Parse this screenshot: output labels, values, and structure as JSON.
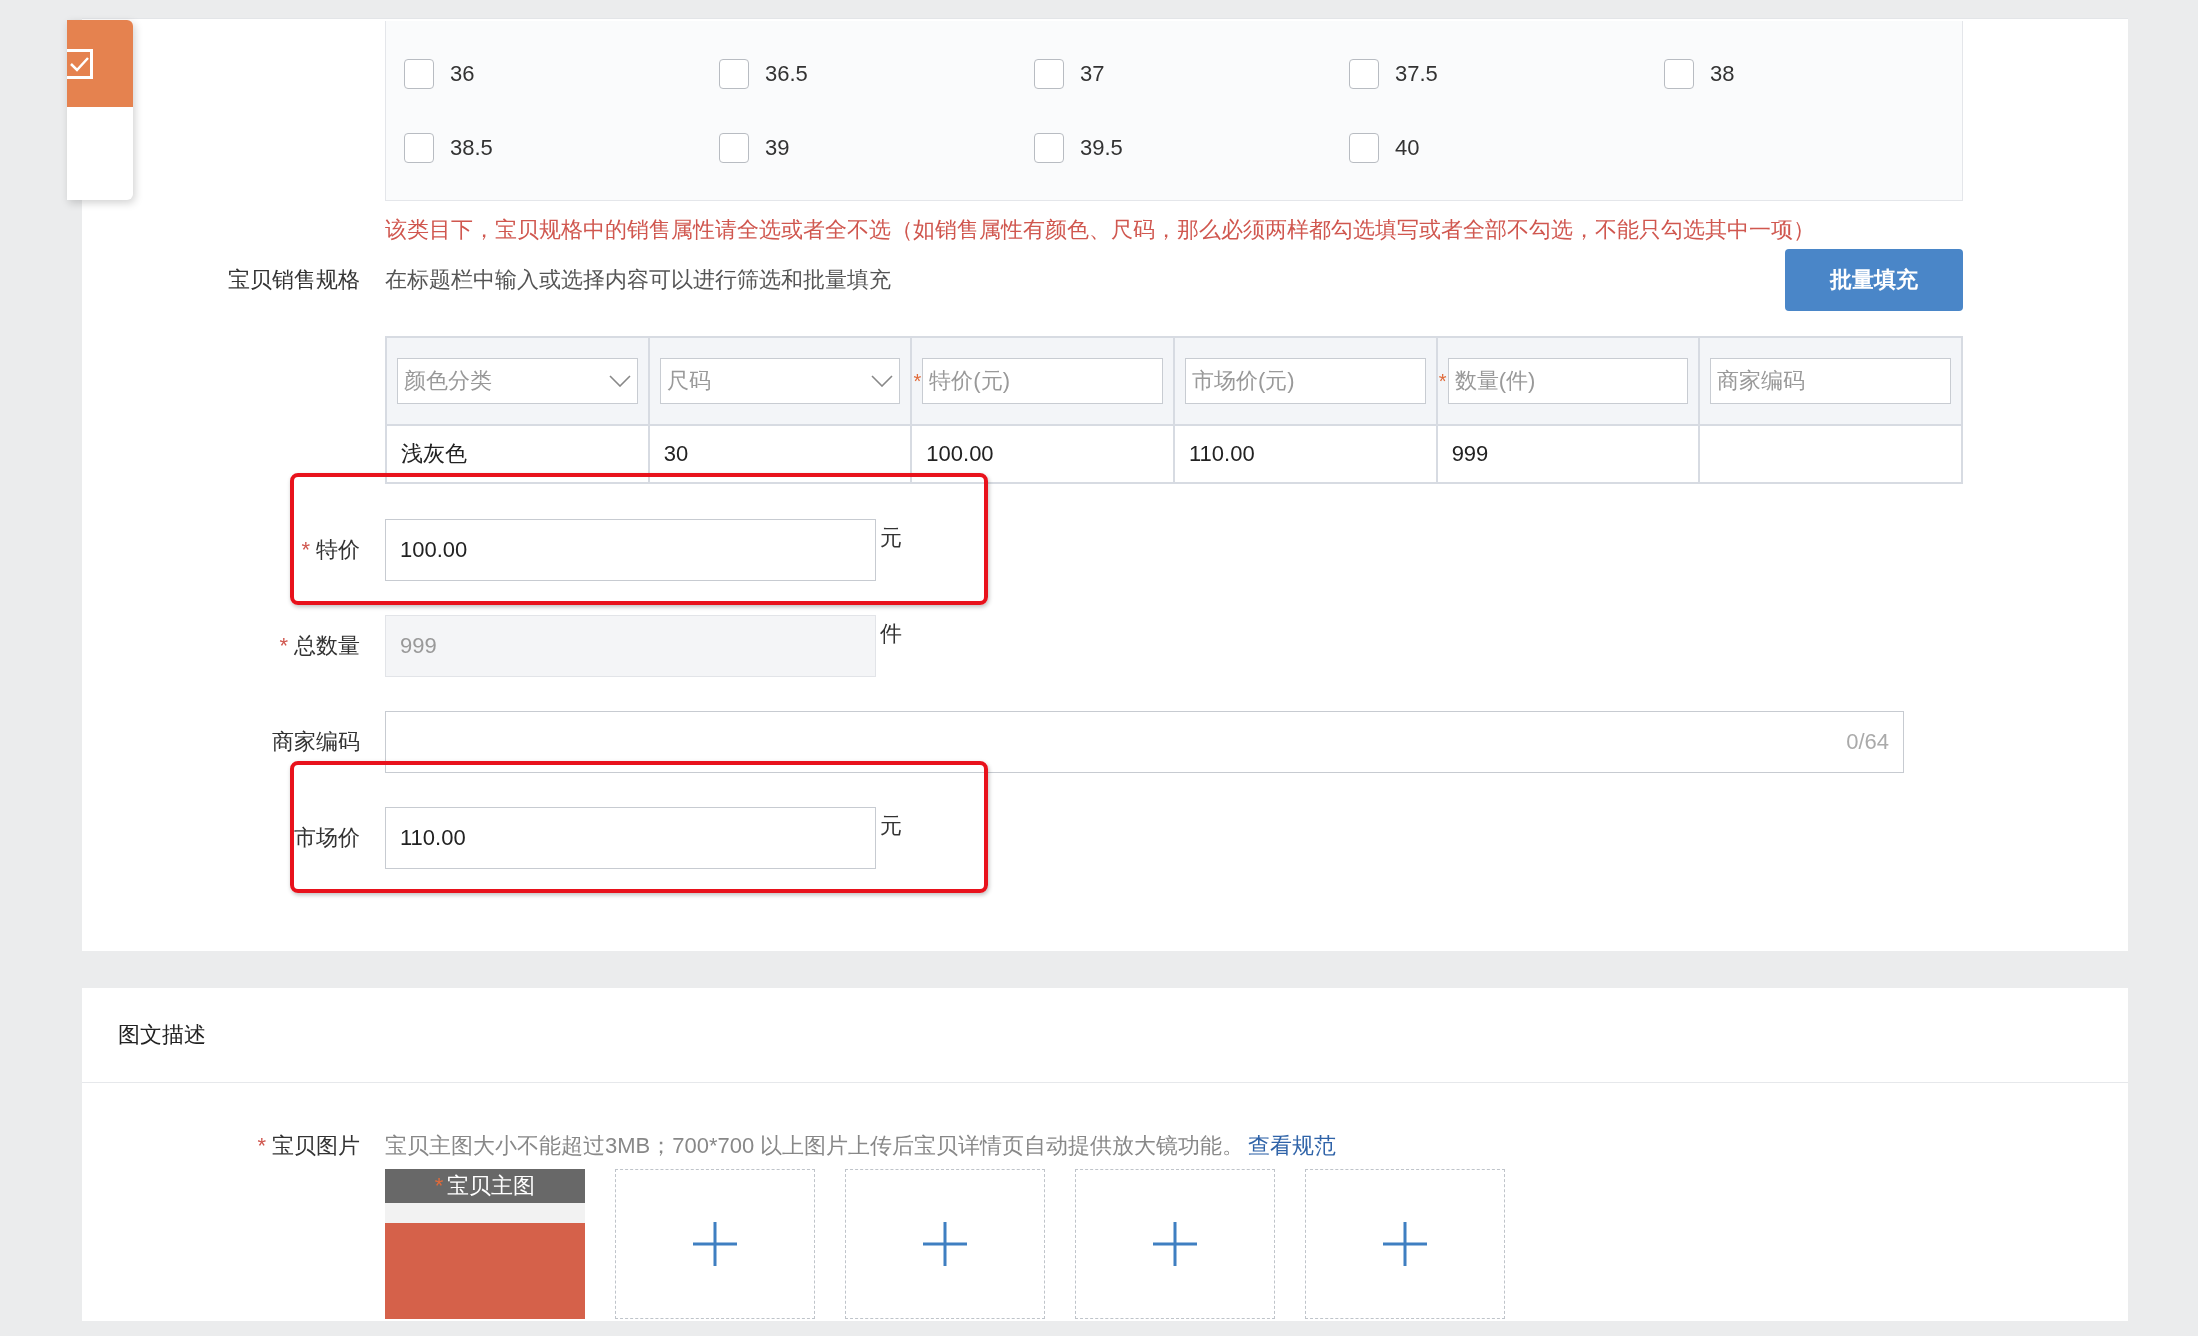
{
  "side_card": {
    "checked": true
  },
  "size_options": [
    {
      "label": "36",
      "checked": false
    },
    {
      "label": "36.5",
      "checked": false
    },
    {
      "label": "37",
      "checked": false
    },
    {
      "label": "37.5",
      "checked": false
    },
    {
      "label": "38",
      "checked": false
    },
    {
      "label": "38.5",
      "checked": false
    },
    {
      "label": "39",
      "checked": false
    },
    {
      "label": "39.5",
      "checked": false
    },
    {
      "label": "40",
      "checked": false
    }
  ],
  "notice": "该类目下，宝贝规格中的销售属性请全选或者全不选（如销售属性有颜色、尺码，那么必须两样都勾选填写或者全部不勾选，不能只勾选其中一项）",
  "sales_spec": {
    "label": "宝贝销售规格",
    "hint": "在标题栏中输入或选择内容可以进行筛选和批量填充",
    "batch_button": "批量填充",
    "columns": [
      {
        "kind": "select",
        "placeholder": "颜色分类"
      },
      {
        "kind": "select",
        "placeholder": "尺码"
      },
      {
        "kind": "input",
        "placeholder": "特价(元)",
        "required_mark": "*"
      },
      {
        "kind": "input",
        "placeholder": "市场价(元)"
      },
      {
        "kind": "input",
        "placeholder": "数量(件)",
        "required_mark": "*"
      },
      {
        "kind": "input",
        "placeholder": "商家编码"
      }
    ],
    "rows": [
      {
        "cells": [
          "浅灰色",
          "30",
          "100.00",
          "110.00",
          "999"
        ]
      }
    ]
  },
  "fields": [
    {
      "kind": "short",
      "label": "特价",
      "required_mark": "*",
      "value": "100.00",
      "unit": "元",
      "disabled": false,
      "highlighted": true
    },
    {
      "kind": "short",
      "label": "总数量",
      "required_mark": "*",
      "value": "999",
      "unit": "件",
      "disabled": true,
      "highlighted": false
    },
    {
      "kind": "wide",
      "label": "商家编码",
      "counter": "0/64",
      "disabled": false,
      "highlighted": false
    },
    {
      "kind": "short",
      "label": "市场价",
      "value": "110.00",
      "unit": "元",
      "disabled": false,
      "highlighted": true
    }
  ],
  "description": {
    "title": "图文描述",
    "image_field": {
      "label": "宝贝图片",
      "required_mark": "*",
      "hint": "宝贝主图大小不能超过3MB；700*700 以上图片上传后宝贝详情页自动提供放大镜功能。",
      "link": "查看规范",
      "slots": [
        {
          "kind": "uploaded",
          "caption": "宝贝主图",
          "caption_mark": "*"
        },
        {
          "kind": "empty"
        },
        {
          "kind": "empty"
        },
        {
          "kind": "empty"
        },
        {
          "kind": "empty"
        }
      ]
    }
  }
}
